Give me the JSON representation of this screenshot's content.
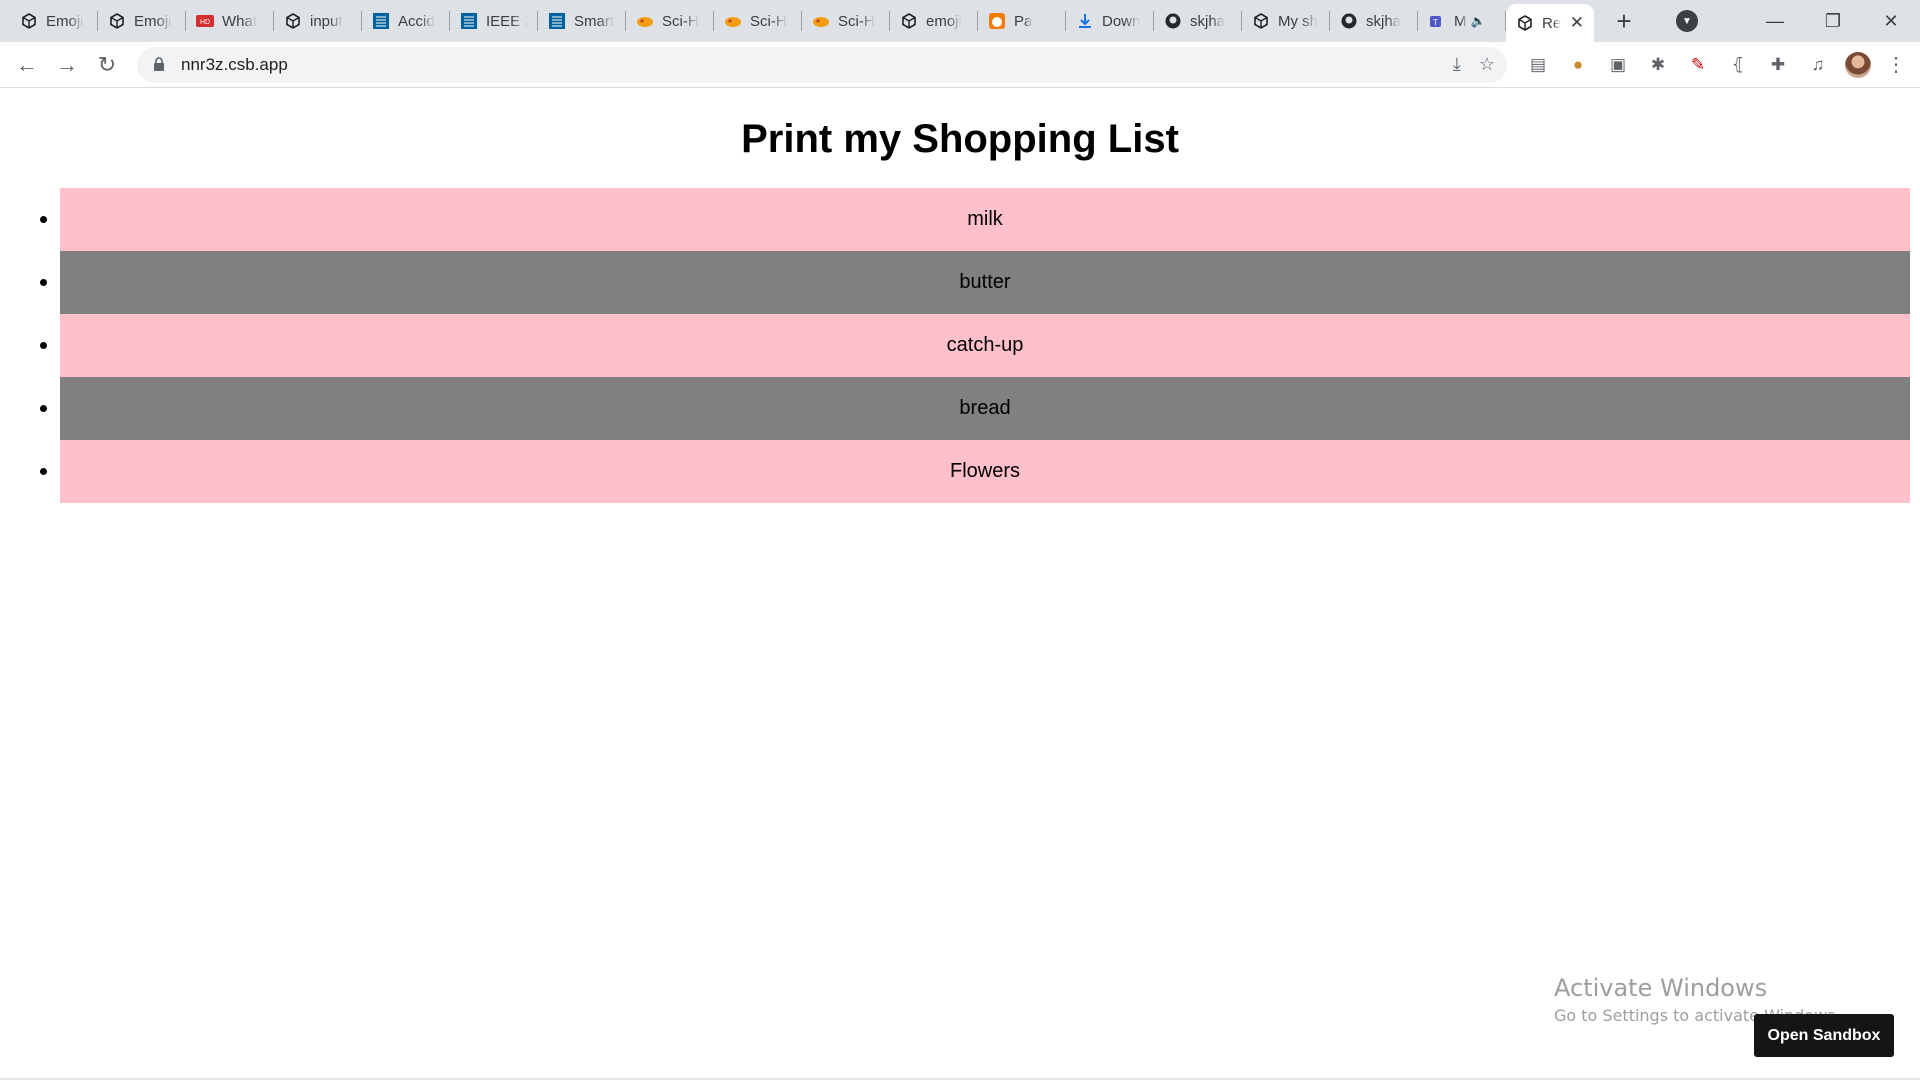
{
  "browser": {
    "tabs": [
      {
        "title": "Emoji",
        "icon": "codesandbox-icon"
      },
      {
        "title": "Emoji",
        "icon": "codesandbox-icon"
      },
      {
        "title": "What",
        "icon": "red-logo-icon"
      },
      {
        "title": "input",
        "icon": "codesandbox-icon"
      },
      {
        "title": "Accid",
        "icon": "ieee-icon"
      },
      {
        "title": "IEEE X",
        "icon": "ieee-icon"
      },
      {
        "title": "Smart",
        "icon": "ieee-icon"
      },
      {
        "title": "Sci-H",
        "icon": "scihub-icon"
      },
      {
        "title": "Sci-H",
        "icon": "scihub-icon"
      },
      {
        "title": "Sci-H",
        "icon": "scihub-icon"
      },
      {
        "title": "emoji",
        "icon": "codesandbox-icon"
      },
      {
        "title": "Pa",
        "icon": "panda-icon"
      },
      {
        "title": "Down",
        "icon": "download-icon"
      },
      {
        "title": "skjha",
        "icon": "github-icon"
      },
      {
        "title": "My sh",
        "icon": "codesandbox-icon"
      },
      {
        "title": "skjha",
        "icon": "github-icon"
      },
      {
        "title": "M",
        "icon": "teams-icon"
      }
    ],
    "active_tab": {
      "title": "Re",
      "icon": "codesandbox-icon"
    },
    "url": "nnr3z.csb.app"
  },
  "page": {
    "heading": "Print my Shopping List",
    "items": [
      "milk",
      "butter",
      "catch-up",
      "bread",
      "Flowers"
    ],
    "row_colors": [
      "#ffc0cb",
      "#808080"
    ]
  },
  "overlay": {
    "watermark_line1": "Activate Windows",
    "watermark_line2": "Go to Settings to activate Windows.",
    "sandbox_button": "Open Sandbox"
  }
}
